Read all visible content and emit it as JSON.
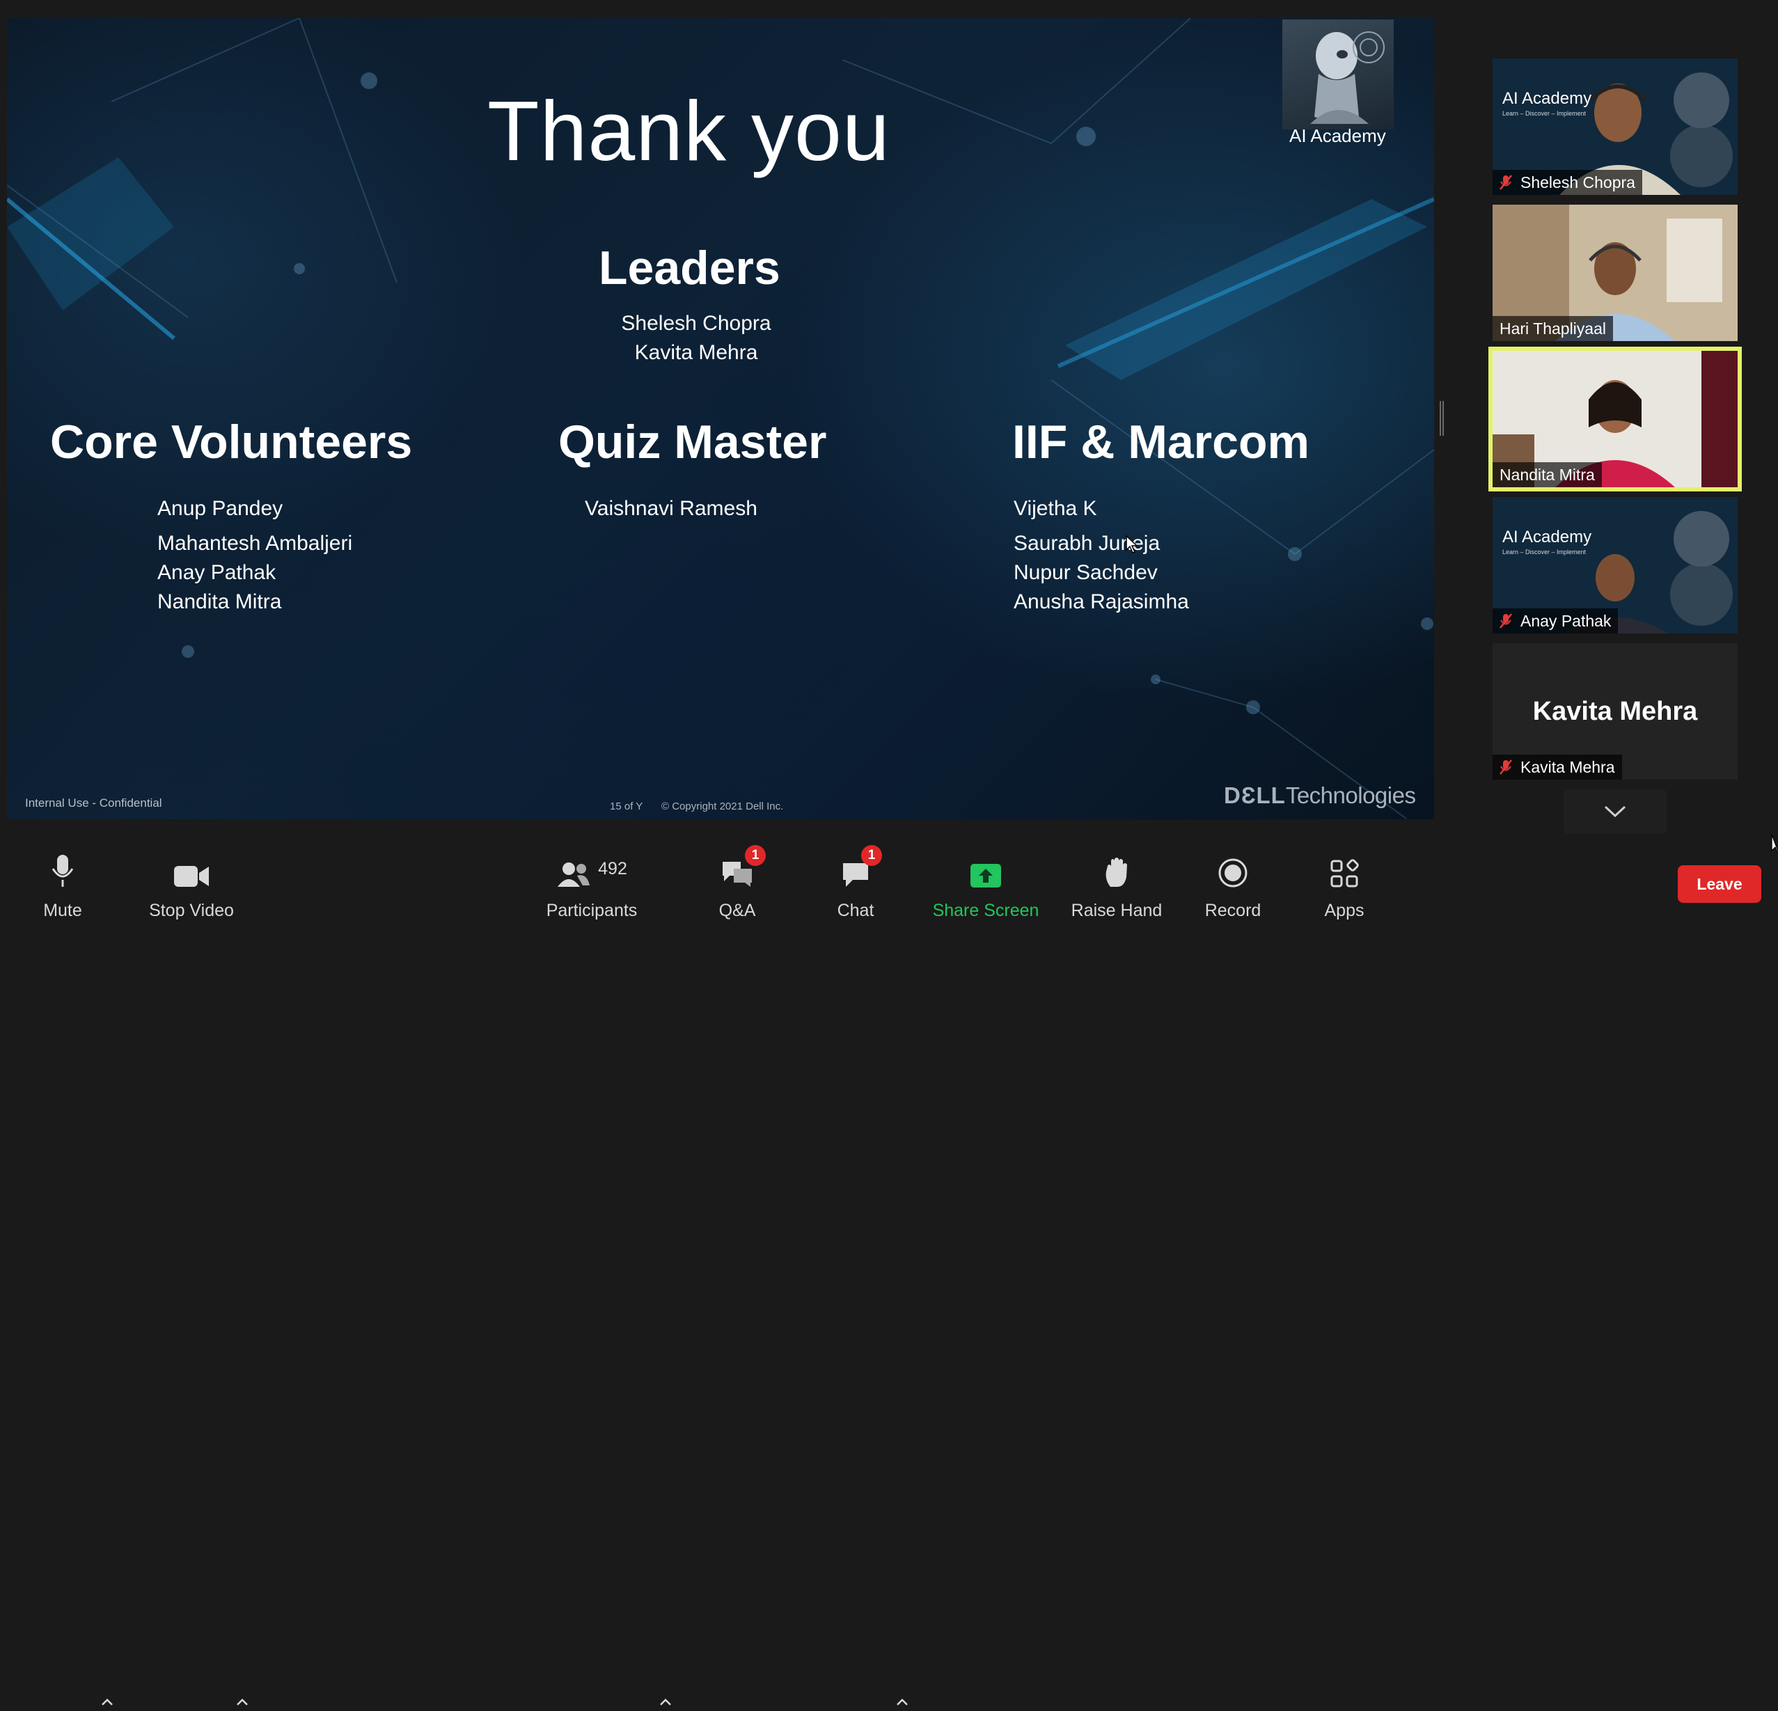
{
  "slide": {
    "title": "Thank you",
    "logo_label": "AI Academy",
    "leaders": {
      "heading": "Leaders",
      "names": [
        "Shelesh Chopra",
        "Kavita Mehra"
      ]
    },
    "core_volunteers": {
      "heading": "Core Volunteers",
      "names": [
        "Anup Pandey",
        "Mahantesh Ambaljeri",
        "Anay Pathak",
        "Nandita Mitra"
      ]
    },
    "quiz_master": {
      "heading": "Quiz Master",
      "names": [
        "Vaishnavi Ramesh"
      ]
    },
    "iif_marcom": {
      "heading": "IIF & Marcom",
      "names": [
        "Vijetha K",
        "Saurabh Juneja",
        "Nupur Sachdev",
        "Anusha Rajasimha"
      ]
    },
    "footer_left": "Internal Use - Confidential",
    "footer_page": "15 of Y",
    "footer_copyright": "© Copyright 2021 Dell Inc.",
    "brand_bold": "DƐLL",
    "brand_rest": "Technologies"
  },
  "gallery": [
    {
      "name": "Shelesh Chopra",
      "muted": true,
      "overlay": "AI Academy",
      "overlay_sub": "Learn – Discover – Implement",
      "active": false
    },
    {
      "name": "Hari Thapliyaal",
      "muted": false,
      "active": false
    },
    {
      "name": "Nandita Mitra",
      "muted": false,
      "active": true
    },
    {
      "name": "Anay Pathak",
      "muted": true,
      "overlay": "AI Academy",
      "overlay_sub": "Learn – Discover – Implement",
      "active": false
    },
    {
      "name": "Kavita Mehra",
      "muted": true,
      "avatar_text": "Kavita Mehra",
      "active": false
    }
  ],
  "toolbar": {
    "mute": "Mute",
    "stop_video": "Stop Video",
    "participants": "Participants",
    "participants_count": "492",
    "qa": "Q&A",
    "qa_badge": "1",
    "chat": "Chat",
    "chat_badge": "1",
    "share_screen": "Share Screen",
    "raise_hand": "Raise Hand",
    "record": "Record",
    "apps": "Apps",
    "leave": "Leave"
  },
  "colors": {
    "leave": "#e02828",
    "share": "#22c55e",
    "active_speaker": "#e4f26a",
    "badge": "#e02828"
  }
}
